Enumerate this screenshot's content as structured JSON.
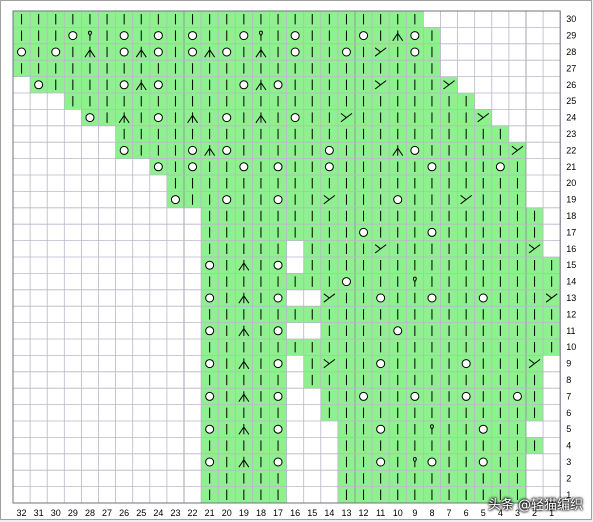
{
  "chart_title": "",
  "colors": {
    "stitch_fill": "#8ef08e",
    "grid_line": "#b8b8c8",
    "grid_major": "#8c8c9c",
    "symbol_stroke": "#000000",
    "background": "#ffffff"
  },
  "grid": {
    "columns": 32,
    "rows": 30
  },
  "column_numbers": [
    32,
    31,
    30,
    29,
    28,
    27,
    26,
    25,
    24,
    23,
    22,
    21,
    20,
    19,
    18,
    17,
    16,
    15,
    14,
    13,
    12,
    11,
    10,
    9,
    8,
    7,
    6,
    5,
    4,
    3,
    2,
    1
  ],
  "row_numbers": [
    30,
    29,
    28,
    27,
    26,
    25,
    24,
    23,
    22,
    21,
    20,
    19,
    18,
    17,
    16,
    15,
    14,
    13,
    12,
    11,
    10,
    9,
    8,
    7,
    6,
    5,
    4,
    3,
    2,
    1
  ],
  "legend_symbols": {
    "|": "knit-stitch",
    "o": "yarn-over",
    "v": "central-double-decrease",
    "x": "cross-stitch",
    "q": "twisted-stitch",
    "#": "no-stitch"
  },
  "chart_rows": [
    "||||||||||||||||||||||||        ",
    "|||oq|o|o|o||oq|o|||o|vo|       ",
    "o|o|v|ovo|ovo|v|o||o|x|o|       ",
    "|||||||||||||||||||||||||       ",
    " o||||ovo||||ovo|||||x|||x      ",
    "   ||||||||||||||||||||||||     ",
    "    o|v|o|v|o|v|o||x|||||||x    ",
    "      |||||||||||||||||||||||   ",
    "      o|||ovo|||||o|||vo|||||x  ",
    "        o|o||o|o||o|||||o|||o|  ",
    "         |||||||||||||||||||||  ",
    "         o||o||o||x|||o|||x|||  ",
    "           |||||||||||||||||||| ",
    "           |||||||||o|||o|||||| ",
    "           ||||| ||||x||||||||x ",
    "           o|v|o |||||||||||||||",
    "           ||||||||o|||q||||||||",
    "           o|v|o  x||o||o||o|||x",
    "           ||||||||||||||||||||||",
    "           o|v|o  ||||o|||||||||",
    "           |||||||||||||||||||||",
    "           o|v|o |x||o||||o|||x",
    "           ||||| ||||||||||||||",
    "           o|v|o  ||o||o||o||o|",
    "           |||||  |||||||||||||",
    "           o|v|o   ||o||q||o||",
    "           |||||   ||||||||||||",
    "           o|v|o   ||o|qo||o||",
    "           |||||   |||||||||||",
    "           |||||   |||||||||||"
  ],
  "watermark": "头条 @轻猫编织"
}
